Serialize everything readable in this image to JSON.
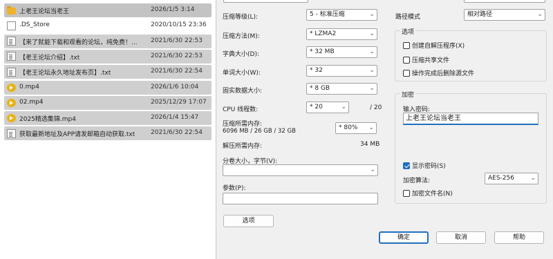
{
  "files": [
    {
      "name": "上老王论坛当老王",
      "date": "2026/1/5 3:14",
      "type": "folder",
      "state": "sel"
    },
    {
      "name": ".DS_Store",
      "date": "2020/10/15 23:36",
      "type": "doc",
      "state": "plain"
    },
    {
      "name": "【来了就能下载和观看的论坛，纯免费！...",
      "date": "2021/6/30 22:53",
      "type": "txt",
      "state": "sel"
    },
    {
      "name": "【老王论坛介绍】.txt",
      "date": "2021/6/30 22:53",
      "type": "txt",
      "state": "sel"
    },
    {
      "name": "【老王论坛永久地址发布页】.txt",
      "date": "2021/6/30 22:54",
      "type": "txt",
      "state": "sel"
    },
    {
      "name": "0.mp4",
      "date": "2026/1/6 10:04",
      "type": "vid",
      "state": "sel"
    },
    {
      "name": "02.mp4",
      "date": "2025/12/29 17:07",
      "type": "vid",
      "state": "sel"
    },
    {
      "name": "2025精选集锦.mp4",
      "date": "2026/1/4 15:47",
      "type": "vid",
      "state": "sel"
    },
    {
      "name": "获取最新地址及APP请发邮箱自动获取.txt",
      "date": "2021/6/30 22:54",
      "type": "txt",
      "state": "sel"
    }
  ],
  "dialog": {
    "compression_level": {
      "label": "压缩等级(L):",
      "value": "5 - 标准压缩"
    },
    "compression_method": {
      "label": "压缩方法(M):",
      "value": "* LZMA2"
    },
    "dictionary_size": {
      "label": "字典大小(D):",
      "value": "* 32 MB"
    },
    "word_size": {
      "label": "单词大小(W):",
      "value": "* 32"
    },
    "solid_block": {
      "label": "固实数据大小:",
      "value": "* 8 GB"
    },
    "cpu_threads": {
      "label": "CPU 线程数:",
      "value": "* 20",
      "max": "/ 20"
    },
    "memory_usage": {
      "label": "压缩所需内存:",
      "detail": "6096 MB / 26 GB / 32 GB",
      "value": "* 80%"
    },
    "decompress_memory": {
      "label": "解压所需内存:",
      "value": "34 MB"
    },
    "split_volume": {
      "label": "分卷大小，字节(V):",
      "value": ""
    },
    "parameters": {
      "label": "参数(P):",
      "value": ""
    },
    "options_button": "选项",
    "path_mode": {
      "label": "路径模式",
      "value": "相对路径"
    },
    "options_group": {
      "title": "选项",
      "items": [
        {
          "label": "创建自解压程序(X)",
          "checked": false
        },
        {
          "label": "压缩共享文件",
          "checked": false
        },
        {
          "label": "操作完成后删除源文件",
          "checked": false
        }
      ]
    },
    "encryption_group": {
      "title": "加密",
      "password_label": "输入密码:",
      "password_value": "上老王论坛当老王",
      "show_password": {
        "label": "显示密码(S)",
        "checked": true
      },
      "method_label": "加密算法:",
      "method_value": "AES-256",
      "encrypt_names": {
        "label": "加密文件名(N)",
        "checked": false
      }
    },
    "buttons": {
      "ok": "确定",
      "cancel": "取消",
      "help": "帮助"
    }
  }
}
